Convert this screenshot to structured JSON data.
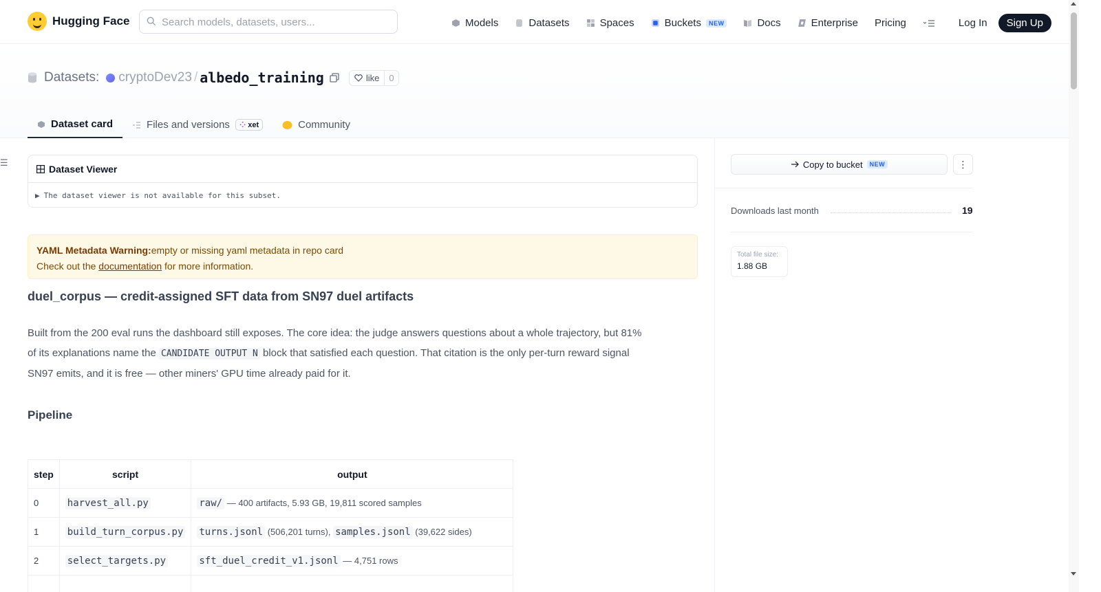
{
  "header": {
    "brand": "Hugging Face",
    "search_placeholder": "Search models, datasets, users...",
    "nav": [
      {
        "label": "Models",
        "icon": "cube-icon"
      },
      {
        "label": "Datasets",
        "icon": "database-icon"
      },
      {
        "label": "Spaces",
        "icon": "grid-icon"
      },
      {
        "label": "Buckets",
        "icon": "bucket-icon",
        "badge": "NEW"
      },
      {
        "label": "Docs",
        "icon": "book-icon"
      },
      {
        "label": "Enterprise",
        "icon": "enterprise-icon"
      },
      {
        "label": "Pricing"
      }
    ],
    "login": "Log In",
    "signup": "Sign Up"
  },
  "repo": {
    "type_label": "Datasets:",
    "owner": "cryptoDev23",
    "separator": "/",
    "name": "albedo_training",
    "like_label": "like",
    "like_count": "0"
  },
  "tabs": [
    {
      "label": "Dataset card",
      "active": true
    },
    {
      "label": "Files and versions",
      "badge": "xet"
    },
    {
      "label": "Community"
    }
  ],
  "viewer": {
    "title": "Dataset Viewer",
    "message": "The dataset viewer is not available for this subset."
  },
  "warning": {
    "bold": "YAML Metadata Warning:",
    "text": "empty or missing yaml metadata in repo card",
    "line2_pre": "Check out the ",
    "link": "documentation",
    "line2_post": " for more information."
  },
  "card": {
    "heading": "duel_corpus — credit-assigned SFT data from SN97 duel artifacts",
    "para_1": "Built from the 200 eval runs the dashboard still exposes. The core idea: the judge answers questions about a whole trajectory, but 81%",
    "para_2_pre": "of its explanations name the ",
    "para_2_code": "CANDIDATE OUTPUT N",
    "para_2_post": " block that satisfied each question. That citation is the only per-turn reward signal",
    "para_3": "SN97 emits, and it is free — other miners' GPU time already paid for it.",
    "section": "Pipeline",
    "table": {
      "headers": [
        "step",
        "script",
        "output"
      ],
      "rows": [
        {
          "step": "0",
          "script": "harvest_all.py",
          "out_code": "raw/",
          "out_text": " — 400 artifacts, 5.93 GB, 19,811 scored samples",
          "out_code2": "",
          "out_text2": ""
        },
        {
          "step": "1",
          "script": "build_turn_corpus.py",
          "out_code": "turns.jsonl",
          "out_text": " (506,201 turns), ",
          "out_code2": "samples.jsonl",
          "out_text2": " (39,622 sides)"
        },
        {
          "step": "2",
          "script": "select_targets.py",
          "out_code": "sft_duel_credit_v1.jsonl",
          "out_text": " — 4,751 rows",
          "out_code2": "",
          "out_text2": ""
        }
      ]
    }
  },
  "sidebar": {
    "copy_button": "Copy to bucket",
    "copy_badge": "NEW",
    "downloads_label": "Downloads last month",
    "downloads_value": "19",
    "file_size_label": "Total file size:",
    "file_size_value": "1.88 GB"
  },
  "colors": {
    "accent": "#111827",
    "warning_bg": "#fef9e7",
    "badge_blue": "#2563eb"
  }
}
